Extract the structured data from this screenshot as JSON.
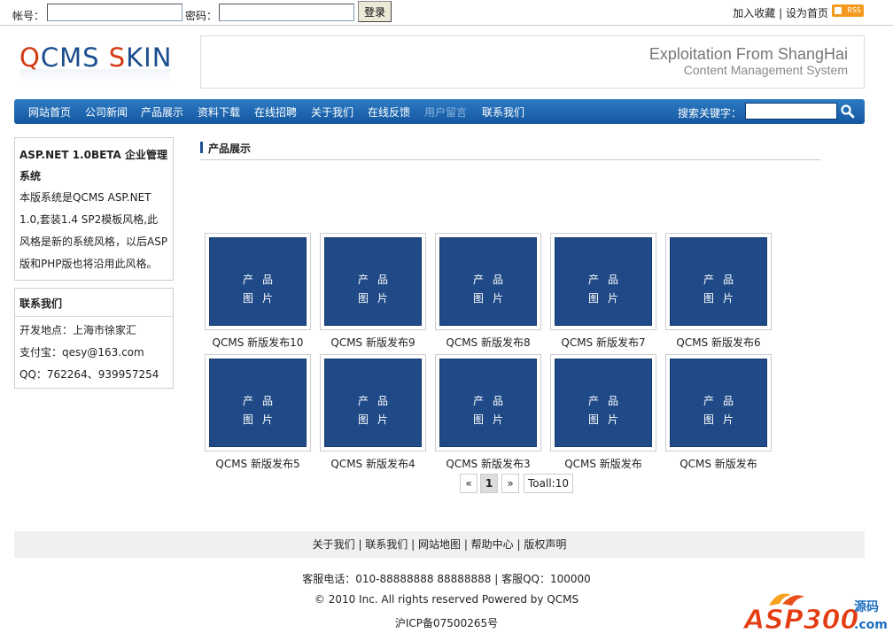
{
  "topbar": {
    "account_label": "帐号：",
    "password_label": "密码：",
    "login_button": "登录",
    "favorite": "加入收藏",
    "separator": "|",
    "set_home": "设为首页",
    "rss": "RSS"
  },
  "logo": {
    "part1": "Q",
    "part2": "CMS ",
    "part3": "S",
    "part4": "KIN"
  },
  "banner": {
    "line1": "Exploitation From ShangHai",
    "line2": "Content Management System"
  },
  "nav": {
    "items": [
      "网站首页",
      "公司新闻",
      "产品展示",
      "资料下载",
      "在线招聘",
      "关于我们",
      "在线反馈",
      "用户留言",
      "联系我们"
    ],
    "search_label": "搜索关键字："
  },
  "sidebar": {
    "intro_title": "ASP.NET 1.0BETA 企业管理系统",
    "intro_text": "本版系统是QCMS ASP.NET 1.0,套装1.4 SP2模板风格,此风格是新的系统风格，以后ASP版和PHP版也将沿用此风格。",
    "contact_title": "联系我们",
    "contact_lines": [
      "开发地点：上海市徐家汇",
      "支付宝：qesy@163.com",
      "QQ：762264、939957254"
    ]
  },
  "main": {
    "title": "产品展示",
    "image_text_1": "产品",
    "image_text_2": "图片",
    "products": [
      "QCMS 新版发布10",
      "QCMS 新版发布9",
      "QCMS 新版发布8",
      "QCMS 新版发布7",
      "QCMS 新版发布6",
      "QCMS 新版发布5",
      "QCMS 新版发布4",
      "QCMS 新版发布3",
      "QCMS 新版发布",
      "QCMS 新版发布"
    ]
  },
  "pager": {
    "prev": "«",
    "current": "1",
    "next": "»",
    "total": "Toall:10"
  },
  "footer": {
    "links": [
      "关于我们",
      "联系我们",
      "网站地图",
      "帮助中心",
      "版权声明"
    ],
    "phone": "客服电话：010-88888888 88888888 | 客服QQ：100000",
    "copyright": "© 2010 Inc. All rights reserved Powered by QCMS",
    "icp": "沪ICP备07500265号"
  },
  "watermark": {
    "text": "ASP300",
    "sub": "源码",
    "domain": ".com"
  },
  "colors": {
    "nav": "#1b5fa8",
    "logo_red": "#d33a12",
    "logo_blue": "#1b4e8f",
    "product": "#1f4a87"
  }
}
